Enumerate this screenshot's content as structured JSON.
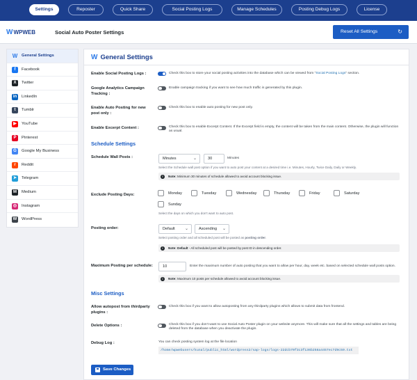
{
  "nav_tabs": [
    "Settings",
    "Reposter",
    "Quick Share",
    "Social Posting Logs",
    "Manage Schedules",
    "Posting Debug Logs",
    "License"
  ],
  "header": {
    "logo_text": "WPWEB",
    "app_title": "Social Auto Poster Settings",
    "reset_label": "Reset All Settings"
  },
  "sidebar": {
    "items": [
      {
        "label": "General Settings",
        "icon": "wpweb-logo-icon",
        "color": "#2e7be8"
      },
      {
        "label": "Facebook",
        "icon": "facebook-icon",
        "color": "#1877f2"
      },
      {
        "label": "Twitter",
        "icon": "twitter-icon",
        "color": "#1d2327"
      },
      {
        "label": "LinkedIn",
        "icon": "linkedin-icon",
        "color": "#0a66c2"
      },
      {
        "label": "Tumblr",
        "icon": "tumblr-icon",
        "color": "#36465d"
      },
      {
        "label": "YouTube",
        "icon": "youtube-icon",
        "color": "#ff0000"
      },
      {
        "label": "Pinterest",
        "icon": "pinterest-icon",
        "color": "#e60023"
      },
      {
        "label": "Google My Business",
        "icon": "google-my-business-icon",
        "color": "#4285f4"
      },
      {
        "label": "Reddit",
        "icon": "reddit-icon",
        "color": "#ff4500"
      },
      {
        "label": "Telegram",
        "icon": "telegram-icon",
        "color": "#229ed9"
      },
      {
        "label": "Medium",
        "icon": "medium-icon",
        "color": "#1d2327"
      },
      {
        "label": "Instagram",
        "icon": "instagram-icon",
        "color": "#d62976"
      },
      {
        "label": "WordPress",
        "icon": "wordpress-icon",
        "color": "#3c434a"
      }
    ]
  },
  "main": {
    "title": "General Settings",
    "enable_logs": {
      "label": "Enable Social Posting Logs :",
      "desc_prefix": "Check this box to store your social posting activities into the database which can be viewed from \"",
      "desc_link": "Social Posting Logs",
      "desc_suffix": "\" section."
    },
    "ga_tracking": {
      "label": "Google Analytics Campaign Tracking :",
      "desc": "Enable campaign tracking if you want to see how much traffic is generated by this plugin."
    },
    "auto_new": {
      "label": "Enable Auto Posting for new post only :",
      "desc": "Check this box to enable auto posting for new post only."
    },
    "excerpt": {
      "label": "Enable Excerpt Content :",
      "desc": "Check this box to enable Excerpt Content. If the Excerpt field is empty, the content will be taken from the main content. Otherwise, the plugin will function as usual."
    },
    "schedule_heading": "Schedule Settings",
    "schedule_wall": {
      "label": "Schedule Wall Posts :",
      "unit": "Minutes",
      "value": "30",
      "suffix": "Minutes",
      "hint": "Select the Schedule wall post option if you want to auto post your content at a desired time i.e. Minutes, Hourly, Twice Daily, Daily or Weekly.",
      "note_bold": "Note:",
      "note": "Minimum 30 minutes of schedule allowed to avoid account blocking issue."
    },
    "exclude_days": {
      "label": "Exclude Posting Days:",
      "days": [
        "Monday",
        "Tuesday",
        "Wednesday",
        "Thursday",
        "Friday",
        "Saturday",
        "Sunday"
      ],
      "hint": "Select the days on which you don't want to auto post."
    },
    "posting_order": {
      "label": "Posting order:",
      "order_by": "Default",
      "direction": "Ascending",
      "hint_prefix": "Select posting order and all scheduled post will be posted as ",
      "hint_bold": "posting order",
      "hint_suffix": ".",
      "note_bold": "Note: Default",
      "note": " - All scheduled post will be posted by post ID in descending order."
    },
    "max_posting": {
      "label": "Maximum Posting per schedule:",
      "value": "10",
      "desc": "Enter the maximum number of auto posting that you want to allow per hour, day, week etc. based on selected schedule wall posts option.",
      "note_bold": "Note:",
      "note": "Maximum 10 posts per schedule allowed to avoid account blocking issue."
    },
    "misc_heading": "Misc Settings",
    "thirdparty": {
      "label": "Allow autopost from thirdparty plugins :",
      "desc": "Check this box if you want to allow autoposting from any thirdparty plugins which allows to submit data from frontend."
    },
    "delete_options": {
      "label": "Delete Options :",
      "desc": "Check this box if you don't want to use Social Auto Poster plugin on your website anymore. This will make sure that all the settings and tables are being deleted from the database when you deactivate the plugin."
    },
    "debug_log": {
      "label": "Debug Log :",
      "desc": "You can check posting system log at the file location",
      "path": "/home/wpwebusers/kunal/public_html/wordpress2/sap-logs/logs-22dcb70f3c3f136b258a4457ec7d9c59.txt"
    },
    "save_label": "Save Changes"
  },
  "colors": {
    "primary": "#1c3f8e",
    "accent": "#1c5dc4",
    "link": "#2271b1"
  }
}
